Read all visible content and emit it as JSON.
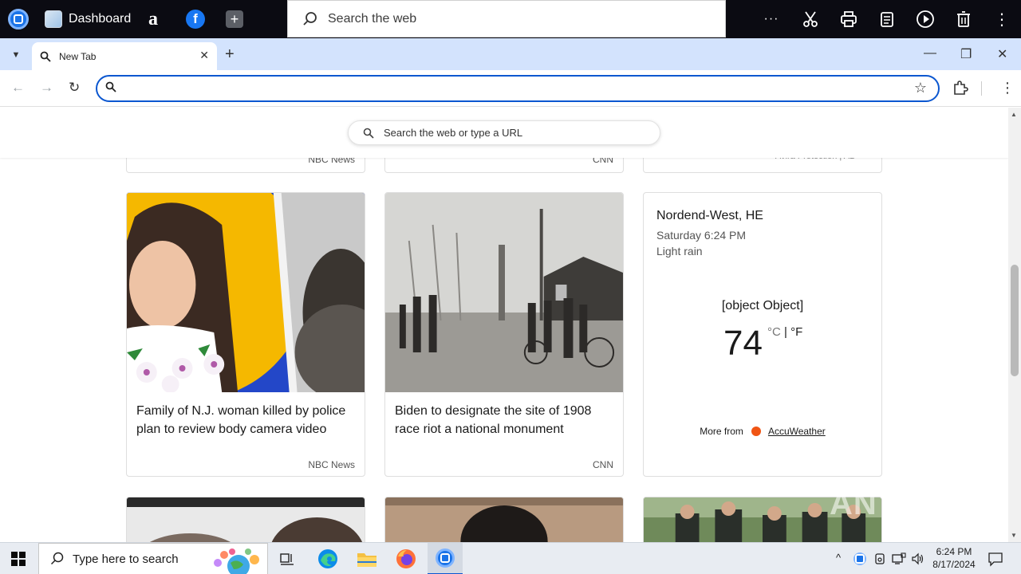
{
  "launcher": {
    "dashboard_label": "Dashboard",
    "amazon_glyph": "a",
    "facebook_glyph": "f",
    "add_glyph": "+",
    "search_label": "Search the web",
    "more_glyph": "···"
  },
  "browser": {
    "tab_title": "New Tab",
    "tab_close": "✕",
    "new_tab": "+",
    "minimize": "—",
    "restore": "❐",
    "close": "✕",
    "dropdown": "▼",
    "back": "←",
    "forward": "→",
    "reload": "↻",
    "star": "☆",
    "menu": "⋮",
    "omnibox_value": ""
  },
  "page": {
    "search_placeholder": "Search the web or type a URL",
    "top_row_sources": [
      "NBC News",
      "CNN",
      "Avira Protection | AD"
    ],
    "cards": [
      {
        "headline": "Family of N.J. woman killed by police plan to review body camera video",
        "source": "NBC News"
      },
      {
        "headline": "Biden to designate the site of 1908 race riot a national monument",
        "source": "CNN"
      }
    ],
    "weather": {
      "location": "Nordend-West, HE",
      "time": "Saturday 6:24 PM",
      "condition": "Light rain",
      "object_text": "[object Object]",
      "temperature": "74",
      "unit_c": "°C",
      "unit_sep": " | ",
      "unit_f": "°F",
      "more_from": "More from",
      "brand": "AccuWeather"
    }
  },
  "watermark": "ANY RUN",
  "taskbar": {
    "search_placeholder": "Type here to search",
    "time": "6:24 PM",
    "date": "8/17/2024",
    "tray_chevron": "^"
  },
  "colors": {
    "accent": "#0b57d0",
    "tabstrip": "#d3e3fd",
    "launcher_bg": "#0b0b12"
  }
}
